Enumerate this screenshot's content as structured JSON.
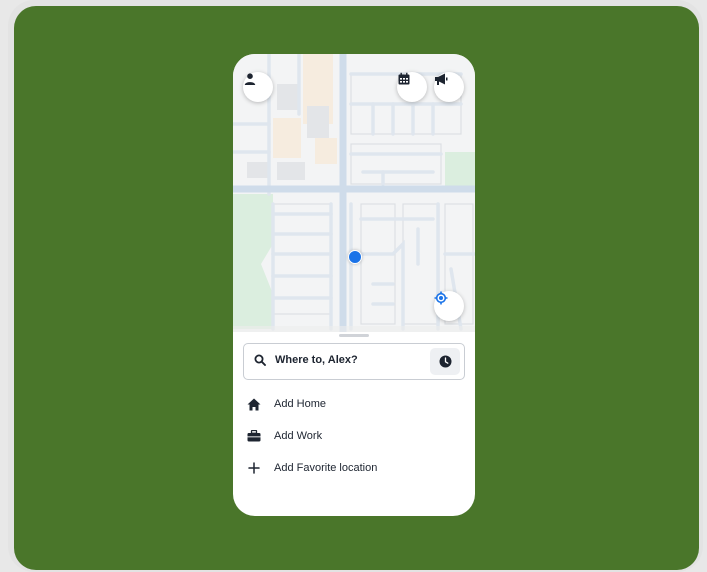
{
  "search": {
    "placeholder_text": "Where to, Alex?"
  },
  "shortcuts": [
    {
      "label": "Add Home",
      "icon": "home-icon"
    },
    {
      "label": "Add Work",
      "icon": "briefcase-icon"
    },
    {
      "label": "Add Favorite location",
      "icon": "plus-icon"
    }
  ],
  "top_buttons": {
    "left": "profile-icon",
    "right": [
      "calendar-icon",
      "megaphone-icon"
    ]
  },
  "colors": {
    "background_green": "#4a762a",
    "accent_blue": "#1a73e8",
    "text_dark": "#1d2430"
  }
}
